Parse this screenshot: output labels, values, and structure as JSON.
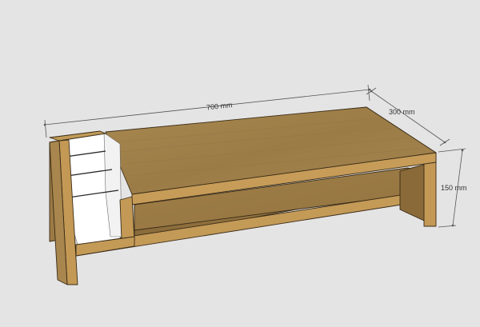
{
  "dimensions": {
    "length": "700 mm",
    "depth": "300 mm",
    "height": "150 mm"
  },
  "colors": {
    "background": "#e4e4e4",
    "wood_top": "#a0804a",
    "wood_front": "#c39955",
    "wood_side": "#b28a4d",
    "wood_dark": "#7a5e32",
    "panel": "#ffffff",
    "dimension_line": "#555555"
  }
}
